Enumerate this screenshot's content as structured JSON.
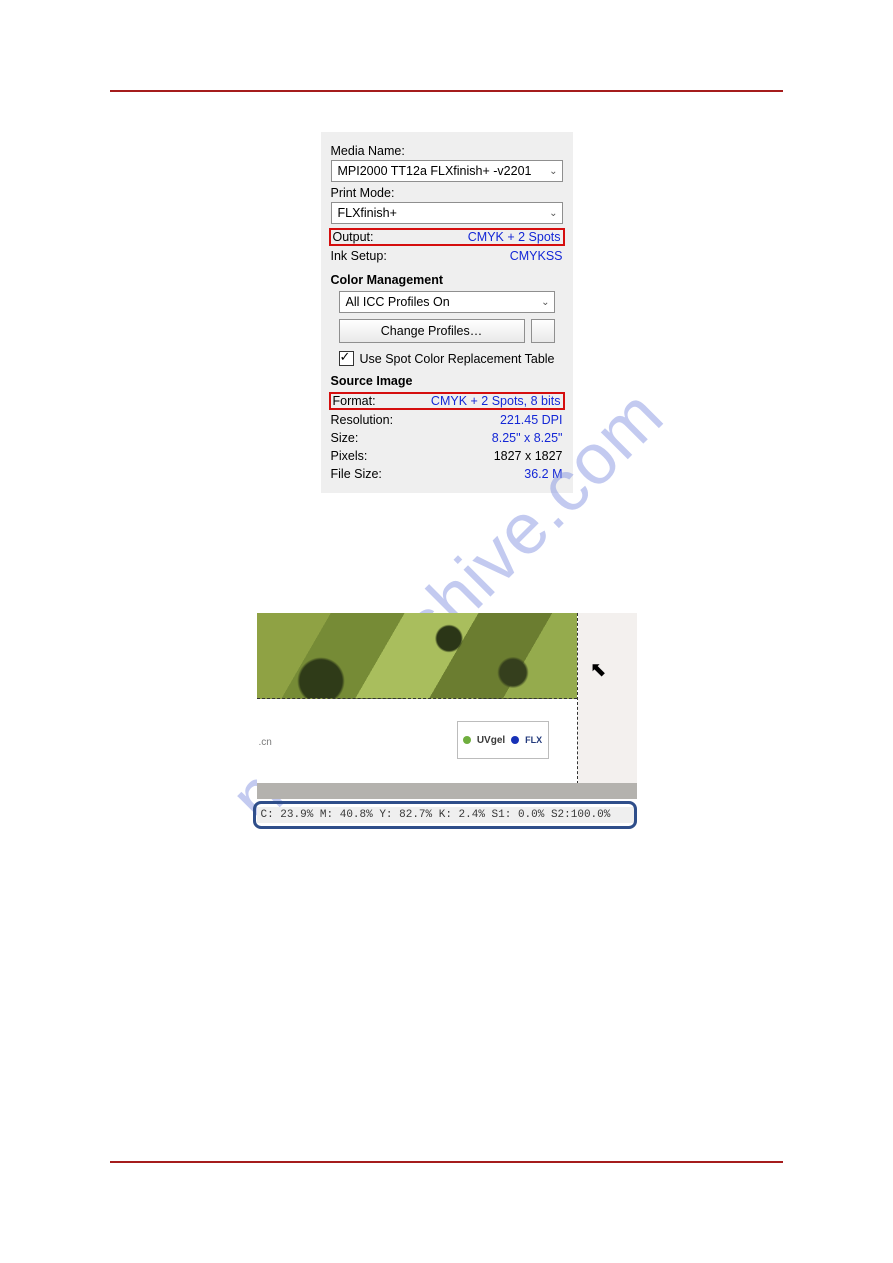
{
  "watermark": "manualshive.com",
  "panel": {
    "media_name_label": "Media Name:",
    "media_name_value": "MPI2000 TT12a FLXfinish+ -v2201",
    "print_mode_label": "Print Mode:",
    "print_mode_value": "FLXfinish+",
    "output_label": "Output:",
    "output_value": "CMYK + 2 Spots",
    "inksetup_label": "Ink Setup:",
    "inksetup_value": "CMYKSS",
    "cm_header": "Color Management",
    "icc_value": "All ICC Profiles On",
    "change_profiles": "Change Profiles…",
    "spot_chk": "Use Spot Color Replacement Table",
    "src_header": "Source Image",
    "format_label": "Format:",
    "format_value": "CMYK + 2 Spots, 8 bits",
    "resolution_label": "Resolution:",
    "resolution_value": "221.45 DPI",
    "size_label": "Size:",
    "size_value": "8.25\" x 8.25\"",
    "pixels_label": "Pixels:",
    "pixels_value": "1827 x 1827",
    "filesize_label": "File Size:",
    "filesize_value": "36.2 M"
  },
  "shot2": {
    "cn": ".cn",
    "logo_uv": "UVgel",
    "logo_flx": "FLX",
    "status": "C: 23.9% M: 40.8% Y: 82.7% K:  2.4% S1:  0.0% S2:100.0%"
  }
}
